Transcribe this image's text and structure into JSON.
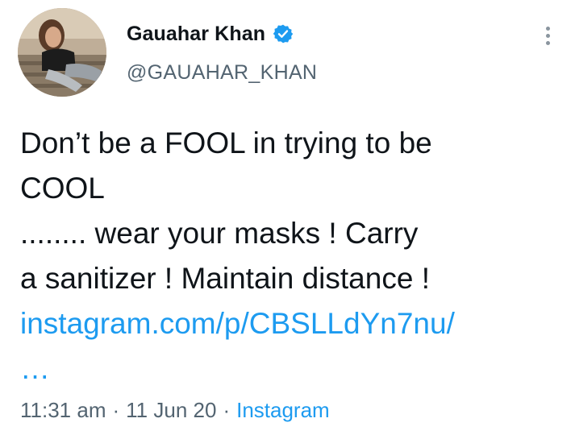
{
  "user": {
    "display_name": "Gauahar Khan",
    "handle": "@GAUAHAR_KHAN",
    "verified": true
  },
  "tweet": {
    "text_lines": [
      "Don’t be a FOOL in trying to be",
      "COOL",
      "........ wear your masks ! Carry",
      "a sanitizer ! Maintain distance !"
    ],
    "link_text": "instagram.com/p/CBSLLdYn7nu/",
    "link_ellipsis": "…"
  },
  "meta": {
    "time": "11:31 am",
    "date": "11 Jun 20",
    "separator": "·",
    "source": "Instagram"
  },
  "colors": {
    "text": "#0f1419",
    "secondary": "#536471",
    "link": "#1d9bf0",
    "verified_badge": "#1d9bf0"
  },
  "icons": {
    "verified": "verified-badge-icon",
    "more": "more-vertical-icon"
  }
}
